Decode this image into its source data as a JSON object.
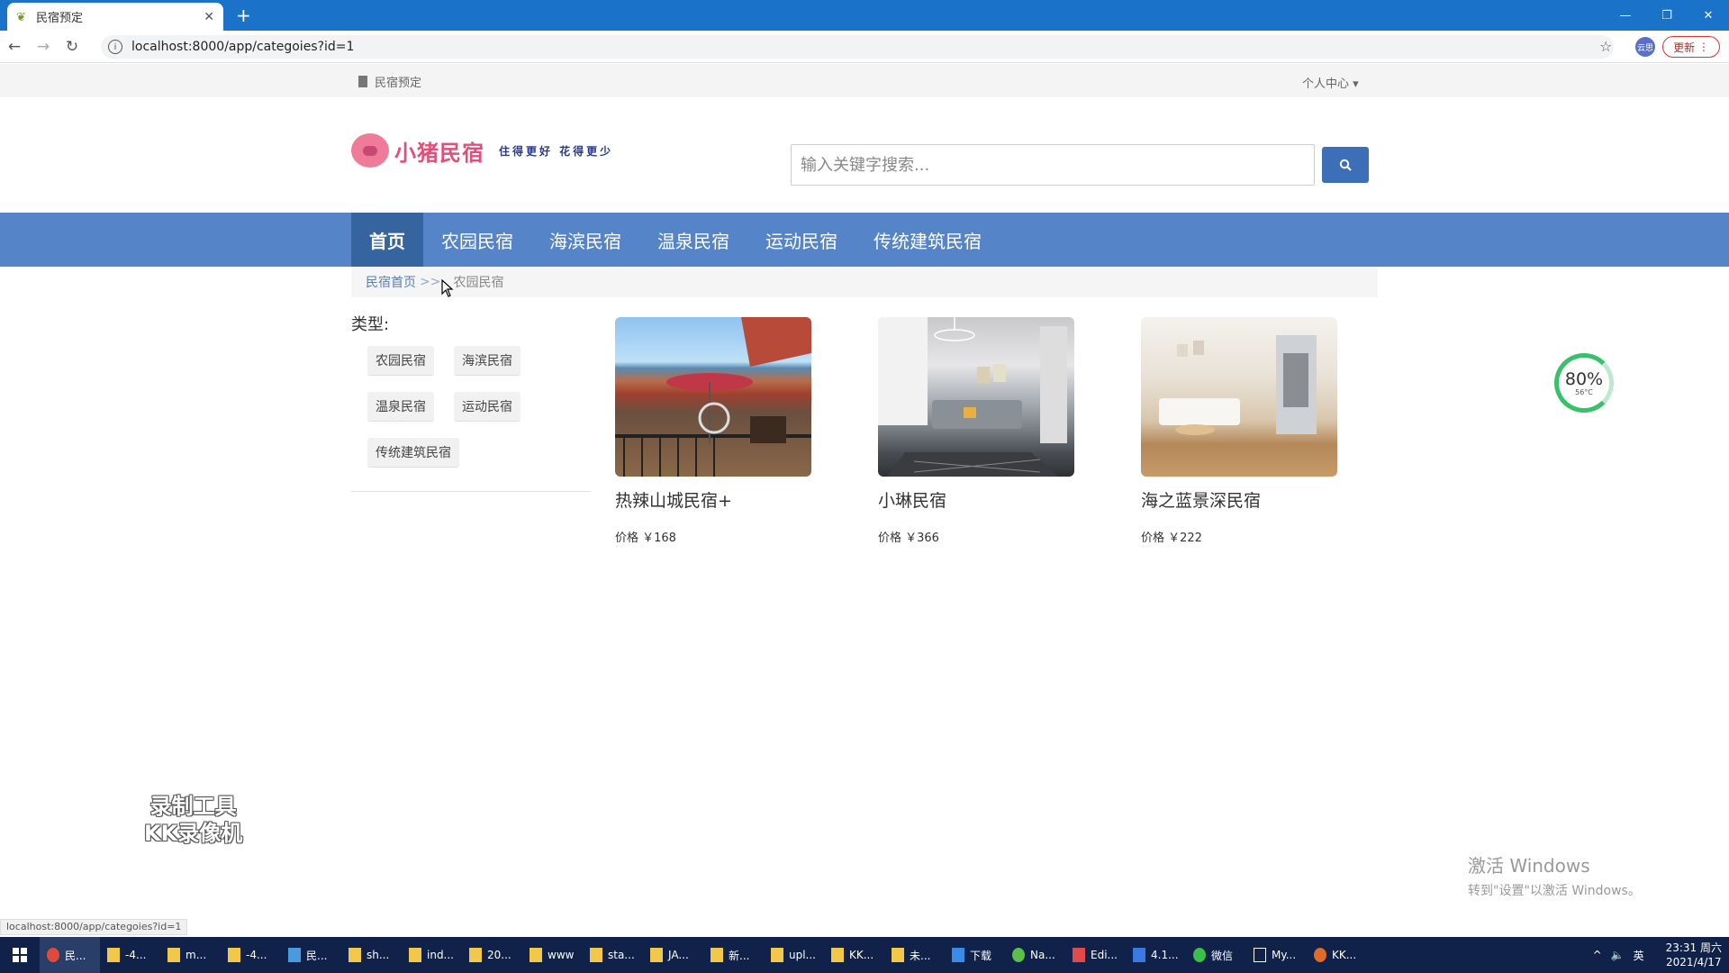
{
  "browser": {
    "tab_title": "民宿预定",
    "url": "localhost:8000/app/categoies?id=1",
    "update_label": "更新",
    "profile_label": "云思"
  },
  "topbar": {
    "brand": "民宿预定",
    "user_center": "个人中心 ▾"
  },
  "header": {
    "logo_name": "小猪民宿",
    "slogan": "住得更好 花得更少",
    "search_placeholder": "输入关键字搜索..."
  },
  "nav": {
    "items": [
      "首页",
      "农园民宿",
      "海滨民宿",
      "温泉民宿",
      "运动民宿",
      "传统建筑民宿"
    ]
  },
  "breadcrumb": {
    "home": "民宿首页",
    "sep": ">>",
    "current": "农园民宿"
  },
  "sidebar": {
    "label": "类型:",
    "tags": [
      "农园民宿",
      "海滨民宿",
      "温泉民宿",
      "运动民宿",
      "传统建筑民宿"
    ]
  },
  "listings": [
    {
      "title": "热辣山城民宿+",
      "price": "价格 ￥168"
    },
    {
      "title": "小琳民宿",
      "price": "价格 ￥366"
    },
    {
      "title": "海之蓝景深民宿",
      "price": "价格 ￥222"
    }
  ],
  "overlay": {
    "gauge_pct": "80%",
    "gauge_temp": "56°C",
    "watermark_line1": "录制工具",
    "watermark_line2": "KK录像机",
    "activate_title": "激活 Windows",
    "activate_sub": "转到\"设置\"以激活 Windows。",
    "status_url": "localhost:8000/app/categoies?id=1"
  },
  "taskbar": {
    "items": [
      "民...",
      "-4...",
      "m...",
      "-4...",
      "民...",
      "sh...",
      "ind...",
      "20...",
      "www",
      "sta...",
      "JA...",
      "新...",
      "upl...",
      "KK...",
      "未...",
      "下载",
      "Na...",
      "Edi...",
      "4.1...",
      "微信",
      "My...",
      "KK..."
    ],
    "ime": "英",
    "time": "23:31 周六",
    "date": "2021/4/17"
  }
}
